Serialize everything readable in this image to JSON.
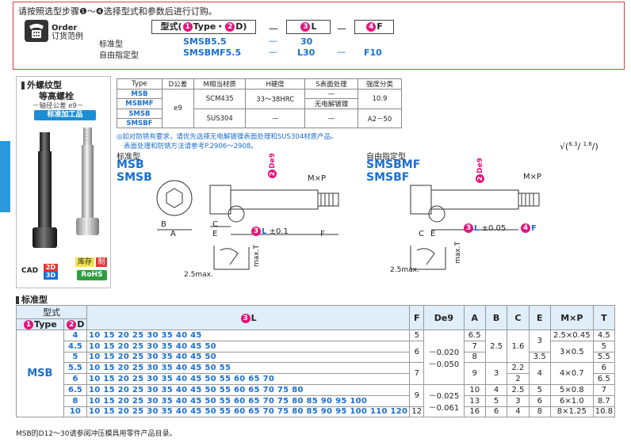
{
  "order": {
    "instruction": "请按照选型步骤❶～❹选择型式和参数后进行订购。",
    "order_en": "Order",
    "order_cn": "订货范例",
    "box_type": "型式(❶Type・❷D)",
    "box_l": "❸L",
    "box_f": "❹F",
    "row1_label": "标准型",
    "row1_type": "SMSB5.5",
    "row1_l": "30",
    "row2_label": "自由指定型",
    "row2_type": "SMSBMF5.5",
    "row2_l": "L30",
    "row2_f": "F10",
    "dash": "—"
  },
  "product": {
    "title1": "外螺纹型",
    "title2": "等高螺栓",
    "subtitle": "－轴径公差 e9－",
    "badge": "标准加工品",
    "cad_label": "CAD",
    "cad_2d": "2D",
    "cad_3d": "3D",
    "stock": "库存",
    "make": "制",
    "rohs": "RoHS"
  },
  "spec": {
    "headers": [
      "Type",
      "D公差",
      "M相当材质",
      "H硬度",
      "S表面处理",
      "强度分类"
    ],
    "rows": [
      {
        "type": "MSB",
        "mat": "SCM435",
        "hard": "33～38HRC",
        "surf": "—",
        "cls": "10.9"
      },
      {
        "type": "MSBMF",
        "surf": "无电解镀镍"
      },
      {
        "type": "SMSB",
        "mat": "SUS304",
        "hard": "—",
        "surf": "—",
        "cls": "A2－50"
      },
      {
        "type": "SMSBF"
      }
    ],
    "tol": "e9",
    "note1": "如对防锈有要求，请优先选择无电解镀镍表面处理和SUS304材质产品。",
    "note2": "表面处理和防锈方法请参考P.2906～2908。"
  },
  "drawings": {
    "std_label": "标准型",
    "std_type1": "MSB",
    "std_type2": "SMSB",
    "free_label": "自由指定型",
    "free_type1": "SMSBMF",
    "free_type2": "SMSBF",
    "mxp": "M×P",
    "l_tol1": "±0.1",
    "l_tol2": "±0.05",
    "max_t": "max.T",
    "max25": "2.5max.",
    "dim_a": "A",
    "dim_b": "B",
    "dim_c": "C",
    "dim_e": "E",
    "dim_f": "F",
    "de9": "De9"
  },
  "table": {
    "section_title": "标准型",
    "h_model": "型式",
    "h_type": "❶Type",
    "h_d": "❷D",
    "h_l": "❸L",
    "h_f": "F",
    "h_de9": "De9",
    "h_a": "A",
    "h_b": "B",
    "h_c": "C",
    "h_e": "E",
    "h_mxp": "M×P",
    "h_t": "T",
    "type_name": "MSB",
    "tol_1": "－0.020",
    "tol_1b": "－0.050",
    "tol_2": "－0.025",
    "tol_2b": "－0.061",
    "rows": [
      {
        "d": "4",
        "l": "10 15 20 25 30 35 40 45",
        "f": "5",
        "a": "6.5",
        "b": "2.5",
        "c": "1.6",
        "e": "3",
        "mxp": "2.5×0.45",
        "t": "4.5"
      },
      {
        "d": "4.5",
        "l": "10 15 20 25 30 35 40 45 50",
        "f": "6",
        "a": "7",
        "mxp": "3×0.5",
        "t": "5"
      },
      {
        "d": "5",
        "l": "10 15 20 25 30 35 40 45 50",
        "a": "8",
        "e": "3.5",
        "t": "5.5"
      },
      {
        "d": "5.5",
        "l": "10 15 20 25 30 35 40 45 50 55",
        "f": "7",
        "a": "9",
        "b": "3",
        "c": "2.2",
        "e": "4",
        "mxp": "4×0.7",
        "t": "6"
      },
      {
        "d": "6",
        "l": "10 15 20 25 30 35 40 45 50 55 60 65 70",
        "c": "2",
        "t": "6.5"
      },
      {
        "d": "6.5",
        "l": "10 15 20 25 30 35 40 45 50 55 60 65 70 75 80",
        "f": "9",
        "a": "10",
        "b": "4",
        "c": "2.5",
        "e": "5",
        "mxp": "5×0.8",
        "t": "7"
      },
      {
        "d": "8",
        "l": "10 15 20 25 30 35 40 45 50 55 60 65 70 75 80 85 90 95 100",
        "a": "13",
        "b": "5",
        "c": "3",
        "e": "6",
        "mxp": "6×1.0",
        "t": "8.7"
      },
      {
        "d": "10",
        "l": "10 15 20 25 30 35 40 45 50 55 60 65 70 75 80 85 90 95 100 110 120",
        "f": "12",
        "a": "16",
        "b": "6",
        "c": "4",
        "e": "8",
        "mxp": "8×1.25",
        "t": "10.8"
      }
    ],
    "footnote": "MSB的D12～30请参阅冲压模具用零件产品目录。"
  }
}
